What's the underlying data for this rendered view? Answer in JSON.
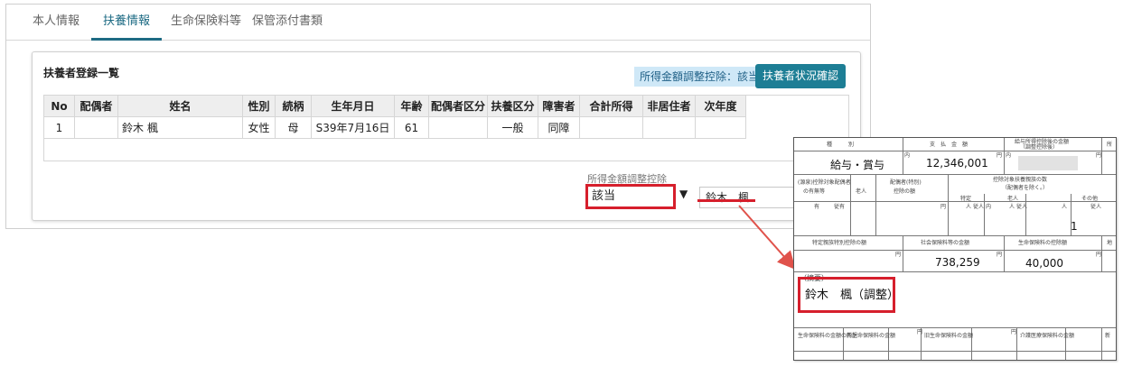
{
  "tabs": [
    {
      "label": "本人情報",
      "active": false
    },
    {
      "label": "扶養情報",
      "active": true
    },
    {
      "label": "生命保険料等",
      "active": false
    },
    {
      "label": "保管添付書類",
      "active": false
    }
  ],
  "panel": {
    "title": "扶養者登録一覧",
    "status_label": "所得金額調整控除：該当",
    "check_button": "扶養者状況確認"
  },
  "table": {
    "headers": [
      "No",
      "配偶者",
      "姓名",
      "性別",
      "続柄",
      "生年月日",
      "年齢",
      "配偶者区分",
      "扶養区分",
      "障害者",
      "合計所得",
      "非居住者",
      "次年度"
    ],
    "rows": [
      [
        "1",
        "",
        "鈴木 楓",
        "女性",
        "母",
        "S39年7月16日",
        "61",
        "",
        "一般",
        "同障",
        "",
        "",
        ""
      ]
    ]
  },
  "adjustment": {
    "label": "所得金額調整控除",
    "selected": "該当",
    "arrow": "▼",
    "name_value": "鈴木　楓"
  },
  "form": {
    "header": {
      "col1": "種　　　別",
      "col2": "支　払　金　額",
      "col3": "給与所得控除後の金額",
      "col3_sub": "（調整控除後）",
      "col4": "所"
    },
    "income_type": "給与・賞与",
    "pay_amount": "12,346,001",
    "unit_en": "円",
    "unit_uchi": "内",
    "row2": {
      "spouse": "(源泉)控除対象配偶者",
      "spouse2": "の有無等",
      "elder": "老人",
      "spouse_ded": "配偶者(特別)",
      "spouse_ded2": "控除の額",
      "dep_title": "控除対象扶養親族の数",
      "dep_sub": "（配偶者を除く。）",
      "tokutei": "特定",
      "rojin": "老人",
      "sonota": "その他"
    },
    "row3": {
      "yu": "有",
      "jyu": "従有",
      "nin": "人",
      "jyunin": "従人",
      "nai": "内"
    },
    "other_count": "1",
    "deduction_header": {
      "col1": "特定親族特別控除の額",
      "col2": "社会保険料等の金額",
      "col3": "生命保険料の控除額",
      "col4": "地"
    },
    "social_insurance": "738,259",
    "life_insurance": "40,000",
    "remarks_label": "（摘要）",
    "remarks_value": "鈴木　楓（調整）",
    "bottom": {
      "c1": "生命保険料の金額の内訳",
      "c2": "新生命保険料の金額",
      "c3": "旧生命保険料の金額",
      "c4": "介護医療保険料の金額",
      "c5": "新"
    }
  },
  "colors": {
    "accent": "#1e6b84",
    "button": "#1d7e95",
    "status_bg": "#cfe8f7",
    "highlight": "#d61f2c"
  }
}
